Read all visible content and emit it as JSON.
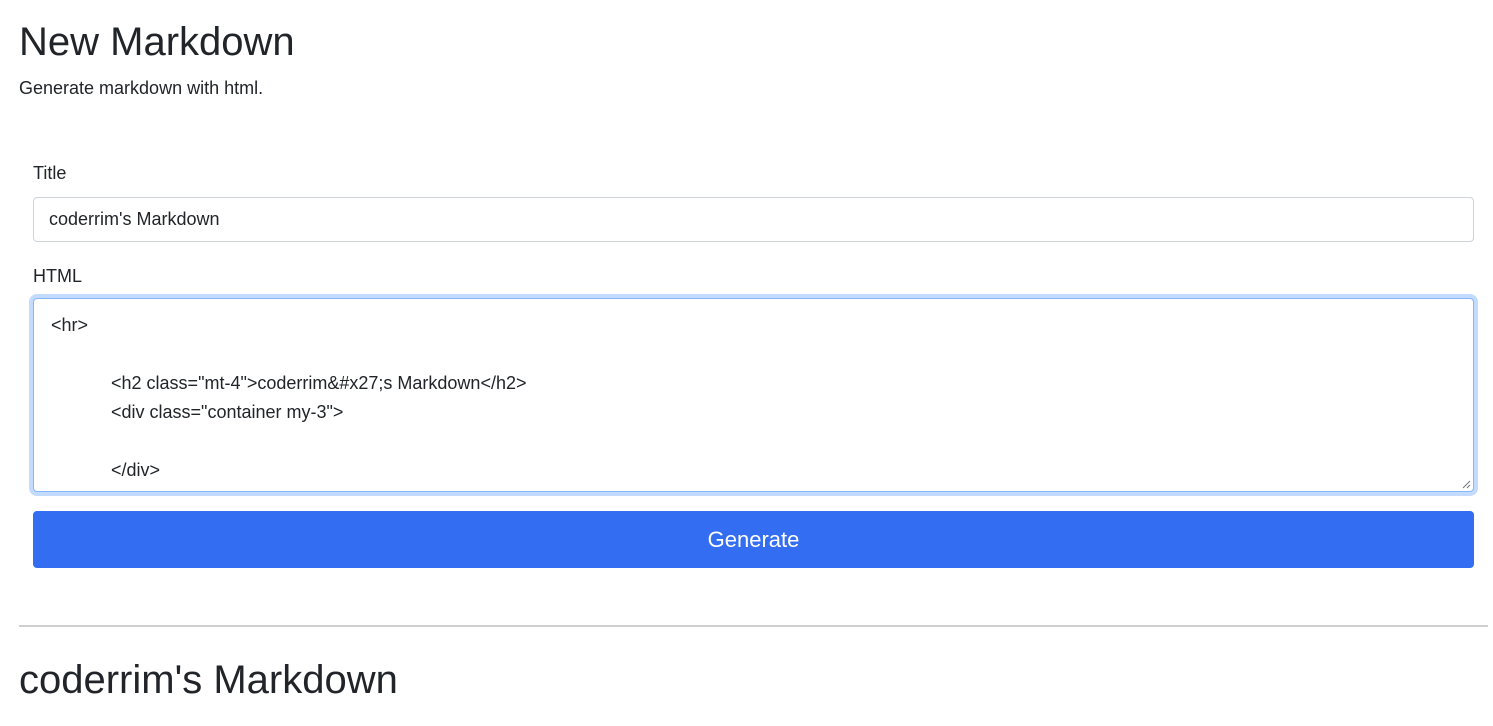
{
  "header": {
    "title": "New Markdown",
    "subtitle": "Generate markdown with html."
  },
  "form": {
    "title_label": "Title",
    "title_value": "coderrim's Markdown",
    "html_label": "HTML",
    "html_value": "<hr>\n\n            <h2 class=\"mt-4\">coderrim&#x27;s Markdown</h2>\n            <div class=\"container my-3\">\n\n            </div>",
    "generate_label": "Generate"
  },
  "result": {
    "title": "coderrim's Markdown"
  },
  "colors": {
    "primary": "#336df2",
    "focus_border": "#86b7fe",
    "divider": "#cfcfcf"
  }
}
